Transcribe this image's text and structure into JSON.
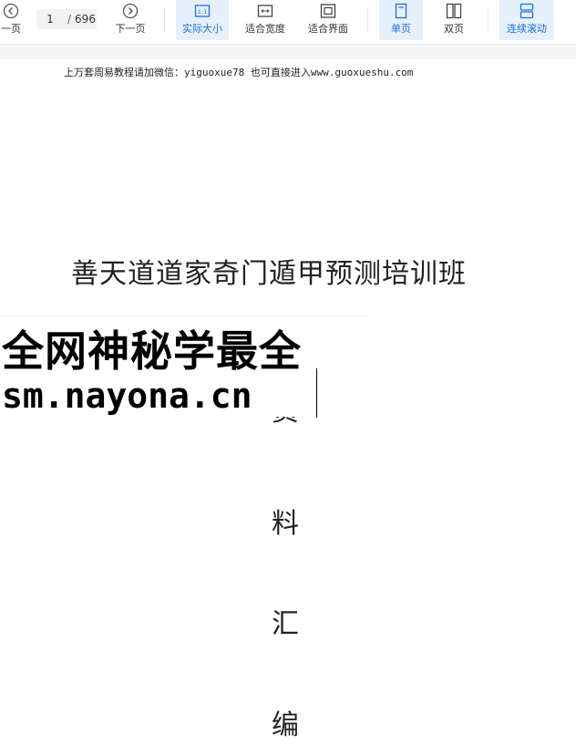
{
  "toolbar": {
    "prev_label": "一页",
    "current_page": "1",
    "page_separator": "/",
    "total_pages": "696",
    "next_label": "下一页",
    "actual_size_label": "实际大小",
    "fit_width_label": "适合宽度",
    "fit_page_label": "适合界面",
    "single_page_label": "单页",
    "double_page_label": "双页",
    "continuous_label": "连续滚动",
    "accent_color": "#1e6fd9",
    "active_bg": "#e6f0fb"
  },
  "document": {
    "header_note": "上万套周易教程请加微信：yiguoxue78  也可直接进入www.guoxueshu.com",
    "title": "善天道道家奇门遁甲预测培训班",
    "vertical_chars": [
      "料",
      "汇",
      "编"
    ],
    "partial_char": "资"
  },
  "watermark": {
    "line1": "全网神秘学最全",
    "line2": "sm.nayona.cn"
  }
}
